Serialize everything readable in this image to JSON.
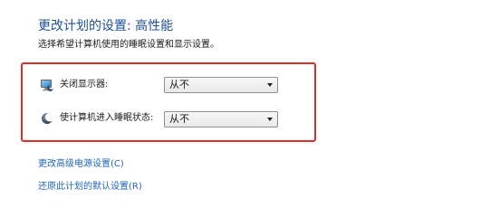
{
  "header": {
    "title": "更改计划的设置: 高性能",
    "subtitle": "选择希望计算机使用的睡眠设置和显示设置。"
  },
  "settings": [
    {
      "icon": "monitor-icon",
      "label": "关闭显示器:",
      "value": "从不"
    },
    {
      "icon": "moon-icon",
      "label": "使计算机进入睡眠状态:",
      "value": "从不"
    }
  ],
  "links": {
    "advanced": "更改高级电源设置(C)",
    "restore": "还原此计划的默认设置(R)"
  },
  "colors": {
    "title": "#1e4f9a",
    "link": "#1f66bd",
    "highlight": "#d9302b"
  }
}
